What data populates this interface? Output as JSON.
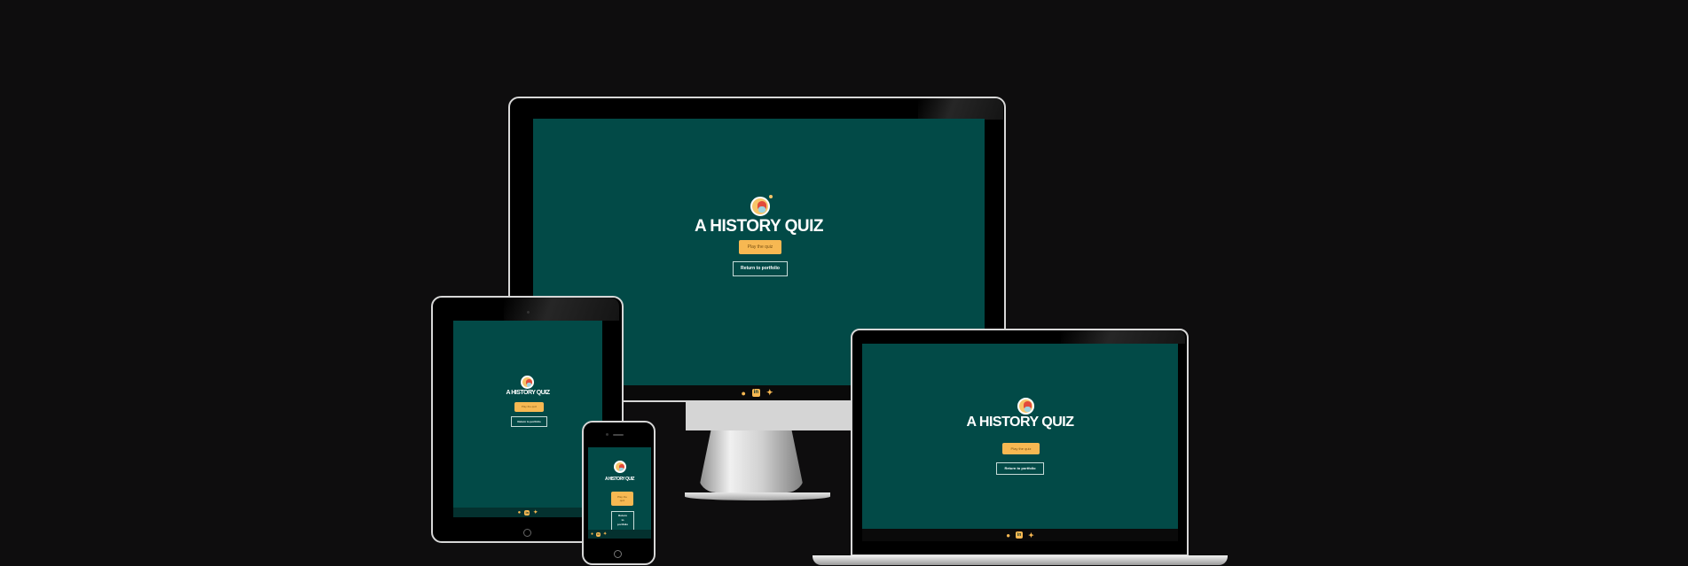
{
  "app": {
    "title": "A HISTORY QUIZ",
    "play_label": "Play the quiz",
    "return_label": "Return to portfolio"
  },
  "footer": {
    "icons": [
      "github-icon",
      "linkedin-icon",
      "twitter-icon"
    ],
    "github_glyph": "●",
    "linkedin_glyph": "in",
    "twitter_glyph": "✦"
  },
  "phone": {
    "play_label_line1": "Play the",
    "play_label_line2": "quiz",
    "return_line1": "Return",
    "return_line2": "to",
    "return_line3": "portfolio"
  },
  "colors": {
    "background": "#0e0d0e",
    "screen": "#024a47",
    "accent": "#f7b852",
    "footer": "#04312f"
  }
}
